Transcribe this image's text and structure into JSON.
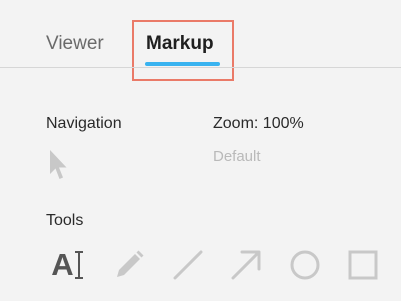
{
  "tabs": [
    {
      "label": "Viewer",
      "active": false
    },
    {
      "label": "Markup",
      "active": true
    }
  ],
  "colors": {
    "accent": "#39b3f0",
    "highlight_border": "#ea7a68",
    "background": "#f3f3f3",
    "muted_icon": "#c8c8c8"
  },
  "navigation": {
    "label": "Navigation",
    "icon": "pointer-icon"
  },
  "zoom": {
    "label": "Zoom: 100%",
    "sub_label": "Default"
  },
  "tools": {
    "label": "Tools",
    "items": [
      {
        "name": "text-tool",
        "icon": "text-icon",
        "glyph": "A"
      },
      {
        "name": "pencil-tool",
        "icon": "pencil-icon"
      },
      {
        "name": "line-tool",
        "icon": "line-icon"
      },
      {
        "name": "arrow-tool",
        "icon": "arrow-icon"
      },
      {
        "name": "circle-tool",
        "icon": "circle-icon"
      },
      {
        "name": "rectangle-tool",
        "icon": "rectangle-icon"
      }
    ]
  }
}
